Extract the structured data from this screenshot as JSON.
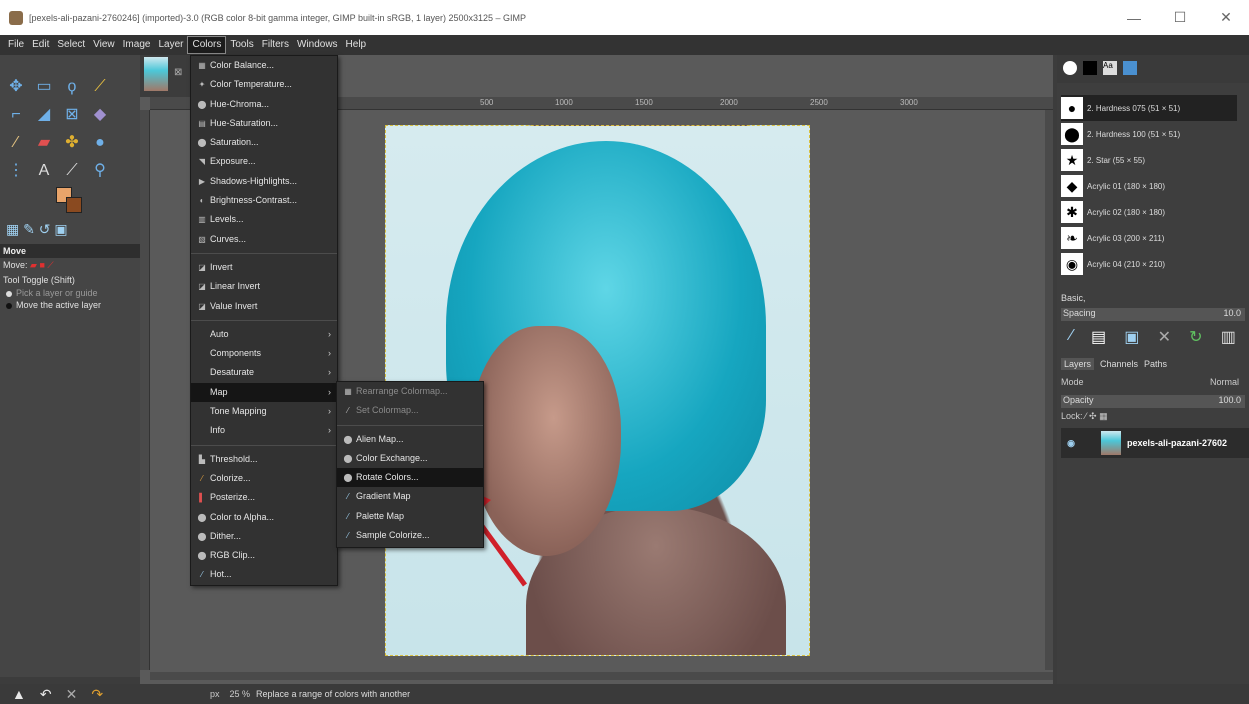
{
  "window": {
    "title": "[pexels-ali-pazani-2760246] (imported)-3.0 (RGB color 8-bit gamma integer, GIMP built-in sRGB, 1 layer) 2500x3125 – GIMP",
    "minimize": "—",
    "maximize": "☐",
    "close": "✕"
  },
  "menubar": [
    "File",
    "Edit",
    "Select",
    "View",
    "Image",
    "Layer",
    "Colors",
    "Tools",
    "Filters",
    "Windows",
    "Help"
  ],
  "colors_menu": {
    "group1": [
      "Color Balance...",
      "Color Temperature...",
      "Hue-Chroma...",
      "Hue-Saturation...",
      "Saturation...",
      "Exposure...",
      "Shadows-Highlights...",
      "Brightness-Contrast...",
      "Levels...",
      "Curves..."
    ],
    "group2": [
      "Invert",
      "Linear Invert",
      "Value Invert"
    ],
    "group3": [
      "Auto",
      "Components",
      "Desaturate",
      "Map",
      "Tone Mapping",
      "Info"
    ],
    "group4": [
      "Threshold...",
      "Colorize...",
      "Posterize...",
      "Color to Alpha...",
      "Dither...",
      "RGB Clip...",
      "Hot..."
    ]
  },
  "map_menu": {
    "disabled": [
      "Rearrange Colormap...",
      "Set Colormap..."
    ],
    "items": [
      "Alien Map...",
      "Color Exchange...",
      "Rotate Colors...",
      "Gradient Map",
      "Palette Map",
      "Sample Colorize..."
    ]
  },
  "tool_options": {
    "title": "Move",
    "move_label": "Move:",
    "toggle": "Tool Toggle  (Shift)",
    "opt1": "Pick a layer or guide",
    "opt2": "Move the active layer"
  },
  "ruler_marks": [
    "500",
    "1000",
    "1500",
    "2000",
    "2500",
    "3000"
  ],
  "brushes": [
    {
      "name": "2. Hardness 075 (51 × 51)",
      "glyph": "●"
    },
    {
      "name": "2. Hardness 100 (51 × 51)",
      "glyph": "⬤"
    },
    {
      "name": "2. Star (55 × 55)",
      "glyph": "★"
    },
    {
      "name": "Acrylic 01 (180 × 180)",
      "glyph": "◆"
    },
    {
      "name": "Acrylic 02 (180 × 180)",
      "glyph": "✱"
    },
    {
      "name": "Acrylic 03 (200 × 211)",
      "glyph": "❧"
    },
    {
      "name": "Acrylic 04 (210 × 210)",
      "glyph": "◉"
    }
  ],
  "brush_preset": "Basic,",
  "spacing": {
    "label": "Spacing",
    "value": "10.0"
  },
  "layer_tabs": [
    "Layers",
    "Channels",
    "Paths"
  ],
  "mode": {
    "label": "Mode",
    "value": "Normal"
  },
  "opacity": {
    "label": "Opacity",
    "value": "100.0"
  },
  "lock": {
    "label": "Lock:"
  },
  "layer": {
    "name": "pexels-ali-pazani-27602"
  },
  "status": {
    "unit": "px",
    "zoom": "25 %",
    "message": "Replace a range of colors with another"
  },
  "accent": {
    "arrow": "#d0202a",
    "selection": "#151515"
  }
}
